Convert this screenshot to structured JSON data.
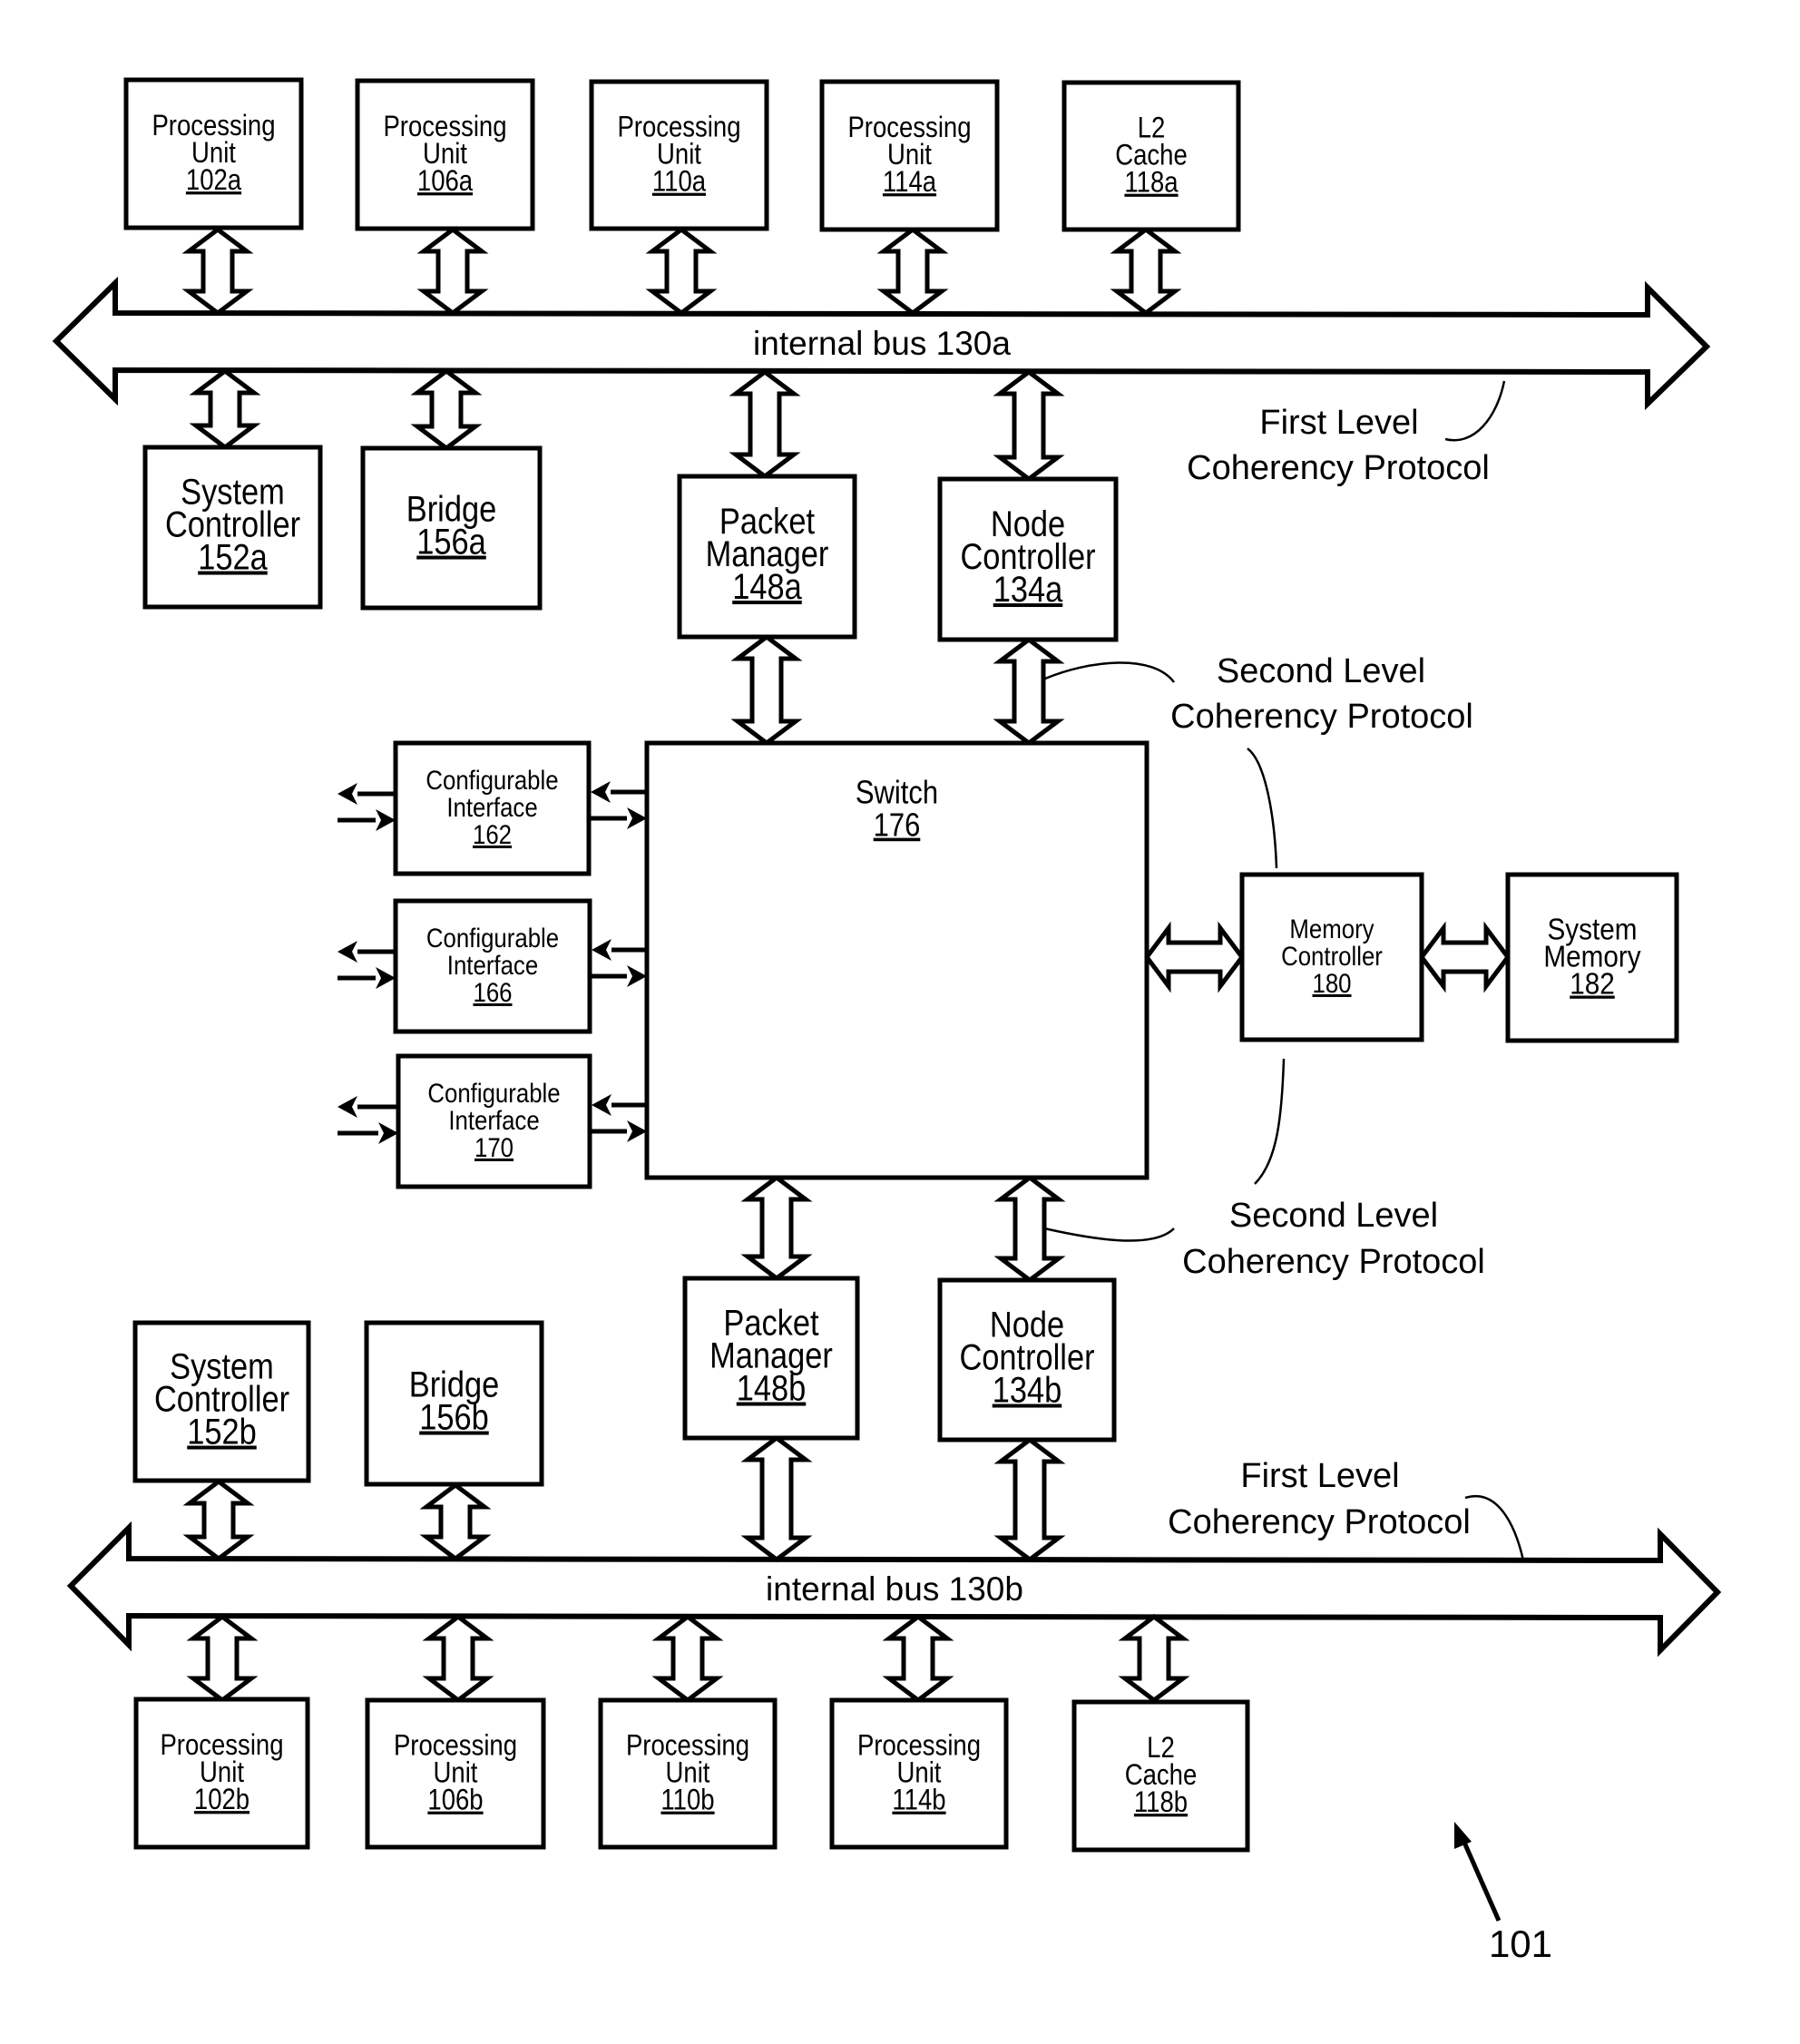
{
  "figure": {
    "reference_numeral": "101"
  },
  "buses": {
    "top": {
      "label": "internal bus 130a"
    },
    "bottom": {
      "label": "internal bus 130b"
    }
  },
  "top_row": [
    {
      "lines": [
        "Processing",
        "Unit"
      ],
      "ref": "102a"
    },
    {
      "lines": [
        "Processing",
        "Unit"
      ],
      "ref": "106a"
    },
    {
      "lines": [
        "Processing",
        "Unit"
      ],
      "ref": "110a"
    },
    {
      "lines": [
        "Processing",
        "Unit"
      ],
      "ref": "114a"
    },
    {
      "lines": [
        "L2",
        "Cache"
      ],
      "ref": "118a"
    }
  ],
  "upper_mid": [
    {
      "lines": [
        "System",
        "Controller"
      ],
      "ref": "152a"
    },
    {
      "lines": [
        "Bridge"
      ],
      "ref": "156a"
    },
    {
      "lines": [
        "Packet",
        "Manager"
      ],
      "ref": "148a"
    },
    {
      "lines": [
        "Node",
        "Controller"
      ],
      "ref": "134a"
    }
  ],
  "interfaces": [
    {
      "lines": [
        "Configurable",
        "Interface"
      ],
      "ref": "162"
    },
    {
      "lines": [
        "Configurable",
        "Interface"
      ],
      "ref": "166"
    },
    {
      "lines": [
        "Configurable",
        "Interface"
      ],
      "ref": "170"
    }
  ],
  "switch": {
    "lines": [
      "Switch"
    ],
    "ref": "176"
  },
  "memory_controller": {
    "lines": [
      "Memory",
      "Controller"
    ],
    "ref": "180"
  },
  "system_memory": {
    "lines": [
      "System",
      "Memory"
    ],
    "ref": "182"
  },
  "lower_mid": [
    {
      "lines": [
        "System",
        "Controller"
      ],
      "ref": "152b"
    },
    {
      "lines": [
        "Bridge"
      ],
      "ref": "156b"
    },
    {
      "lines": [
        "Packet",
        "Manager"
      ],
      "ref": "148b"
    },
    {
      "lines": [
        "Node",
        "Controller"
      ],
      "ref": "134b"
    }
  ],
  "bottom_row": [
    {
      "lines": [
        "Processing",
        "Unit"
      ],
      "ref": "102b"
    },
    {
      "lines": [
        "Processing",
        "Unit"
      ],
      "ref": "106b"
    },
    {
      "lines": [
        "Processing",
        "Unit"
      ],
      "ref": "110b"
    },
    {
      "lines": [
        "Processing",
        "Unit"
      ],
      "ref": "114b"
    },
    {
      "lines": [
        "L2",
        "Cache"
      ],
      "ref": "118b"
    }
  ],
  "annotations": {
    "first_level_top": [
      "First Level",
      "Coherency Protocol"
    ],
    "second_level_top": [
      "Second Level",
      "Coherency Protocol"
    ],
    "second_level_bottom": [
      "Second Level",
      "Coherency Protocol"
    ],
    "first_level_bottom": [
      "First Level",
      "Coherency Protocol"
    ]
  }
}
